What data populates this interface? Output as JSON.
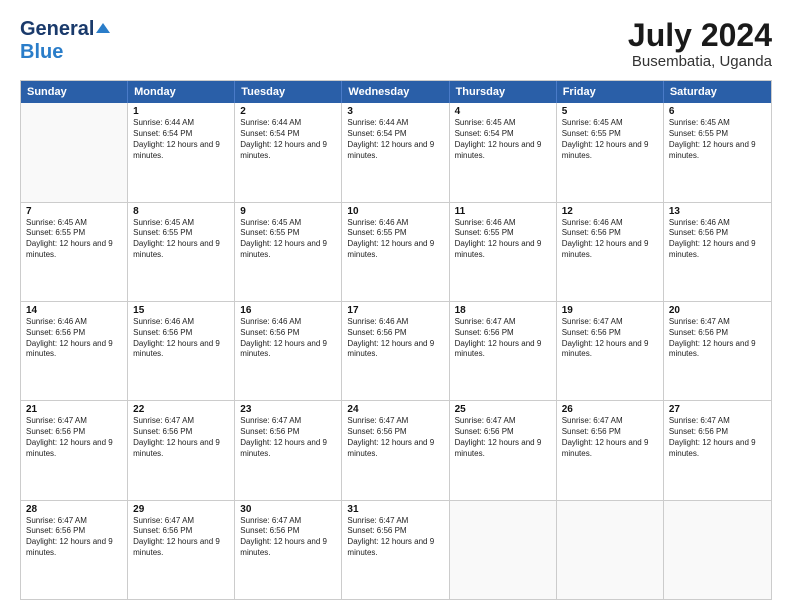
{
  "header": {
    "logo_line1": "General",
    "logo_line2": "Blue",
    "month_year": "July 2024",
    "location": "Busembatia, Uganda"
  },
  "calendar": {
    "weekdays": [
      "Sunday",
      "Monday",
      "Tuesday",
      "Wednesday",
      "Thursday",
      "Friday",
      "Saturday"
    ],
    "weeks": [
      [
        {
          "day": "",
          "sunrise": "",
          "sunset": "",
          "daylight": "",
          "empty": true
        },
        {
          "day": "1",
          "sunrise": "Sunrise: 6:44 AM",
          "sunset": "Sunset: 6:54 PM",
          "daylight": "Daylight: 12 hours and 9 minutes.",
          "empty": false
        },
        {
          "day": "2",
          "sunrise": "Sunrise: 6:44 AM",
          "sunset": "Sunset: 6:54 PM",
          "daylight": "Daylight: 12 hours and 9 minutes.",
          "empty": false
        },
        {
          "day": "3",
          "sunrise": "Sunrise: 6:44 AM",
          "sunset": "Sunset: 6:54 PM",
          "daylight": "Daylight: 12 hours and 9 minutes.",
          "empty": false
        },
        {
          "day": "4",
          "sunrise": "Sunrise: 6:45 AM",
          "sunset": "Sunset: 6:54 PM",
          "daylight": "Daylight: 12 hours and 9 minutes.",
          "empty": false
        },
        {
          "day": "5",
          "sunrise": "Sunrise: 6:45 AM",
          "sunset": "Sunset: 6:55 PM",
          "daylight": "Daylight: 12 hours and 9 minutes.",
          "empty": false
        },
        {
          "day": "6",
          "sunrise": "Sunrise: 6:45 AM",
          "sunset": "Sunset: 6:55 PM",
          "daylight": "Daylight: 12 hours and 9 minutes.",
          "empty": false
        }
      ],
      [
        {
          "day": "7",
          "sunrise": "Sunrise: 6:45 AM",
          "sunset": "Sunset: 6:55 PM",
          "daylight": "Daylight: 12 hours and 9 minutes.",
          "empty": false
        },
        {
          "day": "8",
          "sunrise": "Sunrise: 6:45 AM",
          "sunset": "Sunset: 6:55 PM",
          "daylight": "Daylight: 12 hours and 9 minutes.",
          "empty": false
        },
        {
          "day": "9",
          "sunrise": "Sunrise: 6:45 AM",
          "sunset": "Sunset: 6:55 PM",
          "daylight": "Daylight: 12 hours and 9 minutes.",
          "empty": false
        },
        {
          "day": "10",
          "sunrise": "Sunrise: 6:46 AM",
          "sunset": "Sunset: 6:55 PM",
          "daylight": "Daylight: 12 hours and 9 minutes.",
          "empty": false
        },
        {
          "day": "11",
          "sunrise": "Sunrise: 6:46 AM",
          "sunset": "Sunset: 6:55 PM",
          "daylight": "Daylight: 12 hours and 9 minutes.",
          "empty": false
        },
        {
          "day": "12",
          "sunrise": "Sunrise: 6:46 AM",
          "sunset": "Sunset: 6:56 PM",
          "daylight": "Daylight: 12 hours and 9 minutes.",
          "empty": false
        },
        {
          "day": "13",
          "sunrise": "Sunrise: 6:46 AM",
          "sunset": "Sunset: 6:56 PM",
          "daylight": "Daylight: 12 hours and 9 minutes.",
          "empty": false
        }
      ],
      [
        {
          "day": "14",
          "sunrise": "Sunrise: 6:46 AM",
          "sunset": "Sunset: 6:56 PM",
          "daylight": "Daylight: 12 hours and 9 minutes.",
          "empty": false
        },
        {
          "day": "15",
          "sunrise": "Sunrise: 6:46 AM",
          "sunset": "Sunset: 6:56 PM",
          "daylight": "Daylight: 12 hours and 9 minutes.",
          "empty": false
        },
        {
          "day": "16",
          "sunrise": "Sunrise: 6:46 AM",
          "sunset": "Sunset: 6:56 PM",
          "daylight": "Daylight: 12 hours and 9 minutes.",
          "empty": false
        },
        {
          "day": "17",
          "sunrise": "Sunrise: 6:46 AM",
          "sunset": "Sunset: 6:56 PM",
          "daylight": "Daylight: 12 hours and 9 minutes.",
          "empty": false
        },
        {
          "day": "18",
          "sunrise": "Sunrise: 6:47 AM",
          "sunset": "Sunset: 6:56 PM",
          "daylight": "Daylight: 12 hours and 9 minutes.",
          "empty": false
        },
        {
          "day": "19",
          "sunrise": "Sunrise: 6:47 AM",
          "sunset": "Sunset: 6:56 PM",
          "daylight": "Daylight: 12 hours and 9 minutes.",
          "empty": false
        },
        {
          "day": "20",
          "sunrise": "Sunrise: 6:47 AM",
          "sunset": "Sunset: 6:56 PM",
          "daylight": "Daylight: 12 hours and 9 minutes.",
          "empty": false
        }
      ],
      [
        {
          "day": "21",
          "sunrise": "Sunrise: 6:47 AM",
          "sunset": "Sunset: 6:56 PM",
          "daylight": "Daylight: 12 hours and 9 minutes.",
          "empty": false
        },
        {
          "day": "22",
          "sunrise": "Sunrise: 6:47 AM",
          "sunset": "Sunset: 6:56 PM",
          "daylight": "Daylight: 12 hours and 9 minutes.",
          "empty": false
        },
        {
          "day": "23",
          "sunrise": "Sunrise: 6:47 AM",
          "sunset": "Sunset: 6:56 PM",
          "daylight": "Daylight: 12 hours and 9 minutes.",
          "empty": false
        },
        {
          "day": "24",
          "sunrise": "Sunrise: 6:47 AM",
          "sunset": "Sunset: 6:56 PM",
          "daylight": "Daylight: 12 hours and 9 minutes.",
          "empty": false
        },
        {
          "day": "25",
          "sunrise": "Sunrise: 6:47 AM",
          "sunset": "Sunset: 6:56 PM",
          "daylight": "Daylight: 12 hours and 9 minutes.",
          "empty": false
        },
        {
          "day": "26",
          "sunrise": "Sunrise: 6:47 AM",
          "sunset": "Sunset: 6:56 PM",
          "daylight": "Daylight: 12 hours and 9 minutes.",
          "empty": false
        },
        {
          "day": "27",
          "sunrise": "Sunrise: 6:47 AM",
          "sunset": "Sunset: 6:56 PM",
          "daylight": "Daylight: 12 hours and 9 minutes.",
          "empty": false
        }
      ],
      [
        {
          "day": "28",
          "sunrise": "Sunrise: 6:47 AM",
          "sunset": "Sunset: 6:56 PM",
          "daylight": "Daylight: 12 hours and 9 minutes.",
          "empty": false
        },
        {
          "day": "29",
          "sunrise": "Sunrise: 6:47 AM",
          "sunset": "Sunset: 6:56 PM",
          "daylight": "Daylight: 12 hours and 9 minutes.",
          "empty": false
        },
        {
          "day": "30",
          "sunrise": "Sunrise: 6:47 AM",
          "sunset": "Sunset: 6:56 PM",
          "daylight": "Daylight: 12 hours and 9 minutes.",
          "empty": false
        },
        {
          "day": "31",
          "sunrise": "Sunrise: 6:47 AM",
          "sunset": "Sunset: 6:56 PM",
          "daylight": "Daylight: 12 hours and 9 minutes.",
          "empty": false
        },
        {
          "day": "",
          "sunrise": "",
          "sunset": "",
          "daylight": "",
          "empty": true
        },
        {
          "day": "",
          "sunrise": "",
          "sunset": "",
          "daylight": "",
          "empty": true
        },
        {
          "day": "",
          "sunrise": "",
          "sunset": "",
          "daylight": "",
          "empty": true
        }
      ]
    ]
  }
}
